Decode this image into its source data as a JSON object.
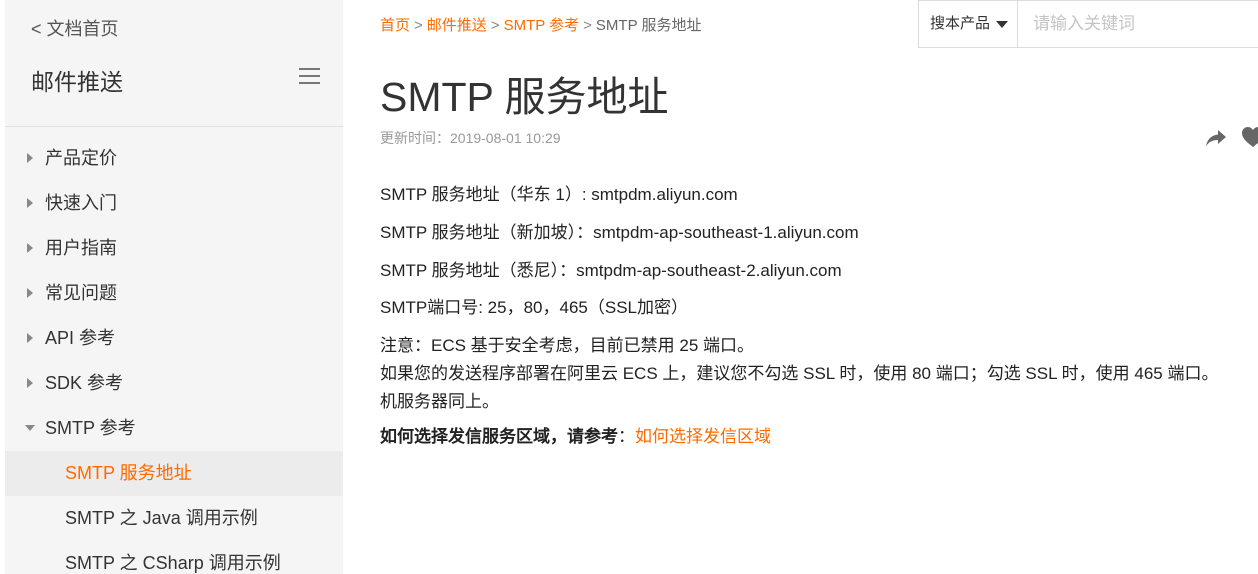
{
  "sidebar": {
    "back_label": "< 文档首页",
    "title": "邮件推送",
    "items": [
      {
        "label": "产品定价"
      },
      {
        "label": "快速入门"
      },
      {
        "label": "用户指南"
      },
      {
        "label": "常见问题"
      },
      {
        "label": "API 参考"
      },
      {
        "label": "SDK 参考"
      },
      {
        "label": "SMTP 参考"
      }
    ],
    "sub_items": [
      {
        "label": "SMTP 服务地址"
      },
      {
        "label": "SMTP 之 Java 调用示例"
      },
      {
        "label": "SMTP 之 CSharp 调用示例"
      }
    ]
  },
  "breadcrumb": {
    "home": "首页",
    "product": "邮件推送",
    "section": "SMTP 参考",
    "current": "SMTP 服务地址",
    "separator": ">"
  },
  "search": {
    "scope_label": "搜本产品",
    "placeholder": "请输入关键词"
  },
  "article": {
    "title": "SMTP 服务地址",
    "updated": "更新时间：2019-08-01 10:29",
    "lines": [
      "SMTP 服务地址（华东 1）: smtpdm.aliyun.com",
      "SMTP 服务地址（新加坡）：smtpdm-ap-southeast-1.aliyun.com",
      "SMTP 服务地址（悉尼）：smtpdm-ap-southeast-2.aliyun.com",
      "SMTP端口号: 25，80，465（SSL加密）",
      "注意：ECS 基于安全考虑，目前已禁用 25 端口。",
      "如果您的发送程序部署在阿里云 ECS 上，建议您不勾选 SSL 时，使用 80 端口；勾选 SSL 时，使用 465 端口。",
      "机服务器同上。"
    ],
    "region_prompt": "如何选择发信服务区域，请参考",
    "region_colon": "：",
    "region_link": "如何选择发信区域"
  },
  "colors": {
    "accent": "#ff6a00",
    "sidebar_bg": "#f5f5f5"
  },
  "icons": {
    "share": "share-icon",
    "favorite": "heart-icon",
    "menu": "hamburger-icon"
  }
}
